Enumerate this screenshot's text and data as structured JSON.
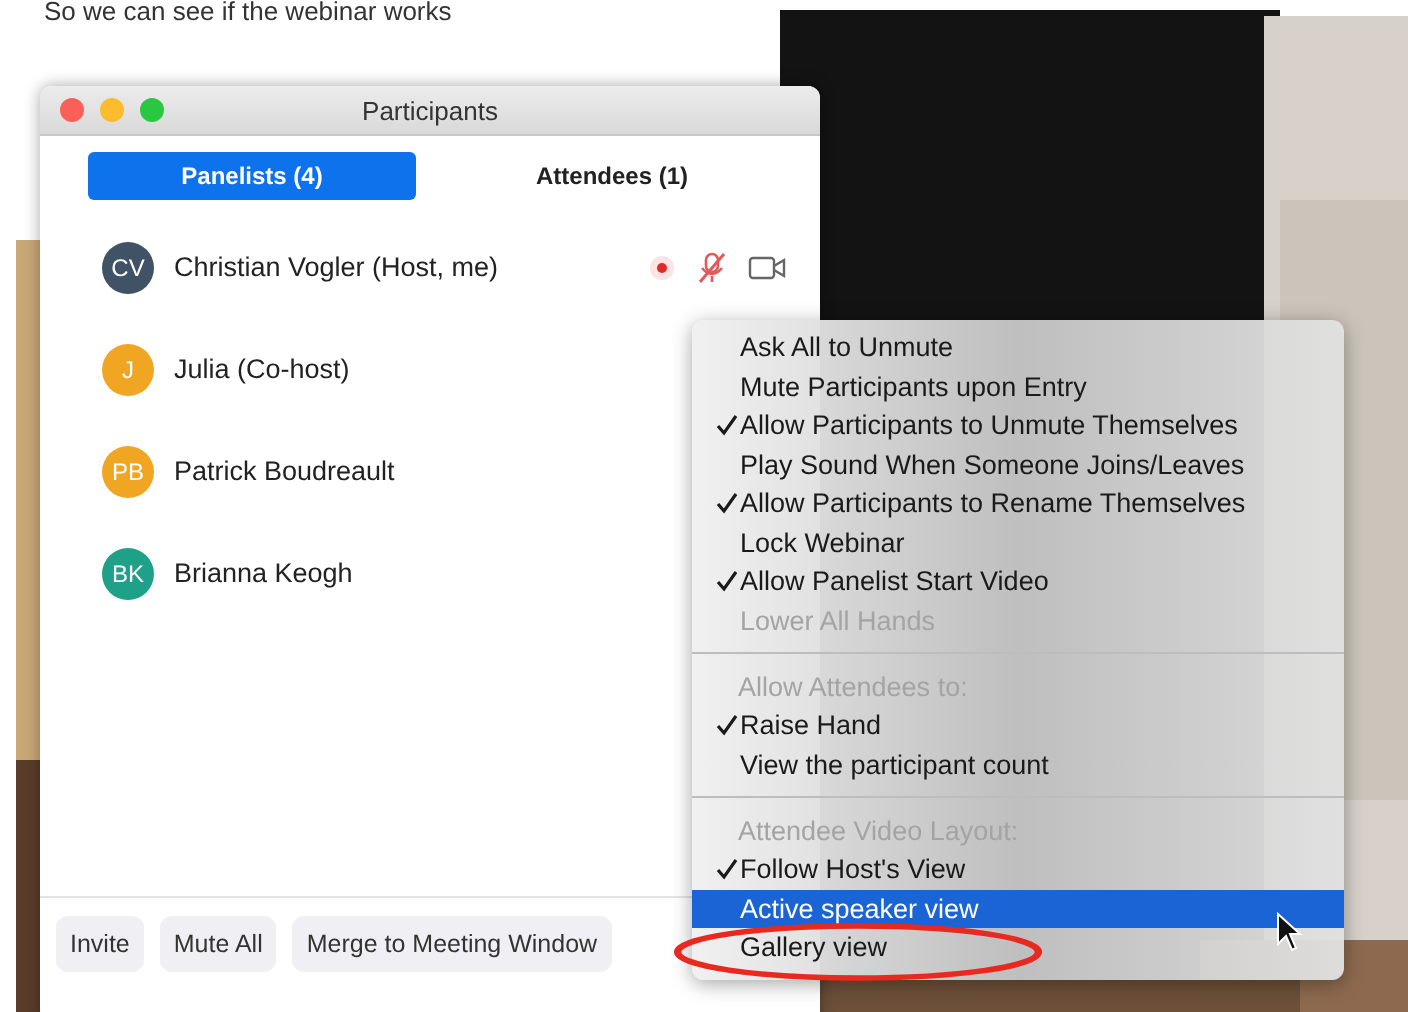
{
  "caption": "So we can see if the webinar works",
  "window": {
    "title": "Participants"
  },
  "tabs": [
    {
      "label": "Panelists (4)",
      "selected": true
    },
    {
      "label": "Attendees (1)",
      "selected": false
    }
  ],
  "participants": [
    {
      "initials": "CV",
      "name": "Christian Vogler (Host, me)",
      "color": "#3f5266",
      "hovered": true
    },
    {
      "initials": "J",
      "name": "Julia (Co-host)",
      "color": "#f0a623",
      "hovered": false
    },
    {
      "initials": "PB",
      "name": "Patrick Boudreault",
      "color": "#f0a623",
      "hovered": false
    },
    {
      "initials": "BK",
      "name": "Brianna Keogh",
      "color": "#1fa089",
      "hovered": false
    }
  ],
  "buttons": [
    "Invite",
    "Mute All",
    "Merge to Meeting Window"
  ],
  "menu": [
    {
      "kind": "item",
      "label": "Ask All to Unmute",
      "checked": false,
      "disabled": false,
      "selected": false
    },
    {
      "kind": "item",
      "label": "Mute Participants upon Entry",
      "checked": false,
      "disabled": false,
      "selected": false
    },
    {
      "kind": "item",
      "label": "Allow Participants to Unmute Themselves",
      "checked": true,
      "disabled": false,
      "selected": false
    },
    {
      "kind": "item",
      "label": "Play Sound When Someone Joins/Leaves",
      "checked": false,
      "disabled": false,
      "selected": false
    },
    {
      "kind": "item",
      "label": "Allow Participants to Rename Themselves",
      "checked": true,
      "disabled": false,
      "selected": false
    },
    {
      "kind": "item",
      "label": "Lock Webinar",
      "checked": false,
      "disabled": false,
      "selected": false
    },
    {
      "kind": "item",
      "label": "Allow Panelist Start Video",
      "checked": true,
      "disabled": false,
      "selected": false
    },
    {
      "kind": "item",
      "label": "Lower All Hands",
      "checked": false,
      "disabled": true,
      "selected": false
    },
    {
      "kind": "separator"
    },
    {
      "kind": "header",
      "label": "Allow Attendees to:"
    },
    {
      "kind": "item",
      "label": "Raise Hand",
      "checked": true,
      "disabled": false,
      "selected": false
    },
    {
      "kind": "item",
      "label": "View the participant count",
      "checked": false,
      "disabled": false,
      "selected": false
    },
    {
      "kind": "separator"
    },
    {
      "kind": "header",
      "label": "Attendee Video Layout:"
    },
    {
      "kind": "item",
      "label": "Follow Host's View",
      "checked": true,
      "disabled": false,
      "selected": false
    },
    {
      "kind": "item",
      "label": "Active speaker view",
      "checked": false,
      "disabled": false,
      "selected": true
    },
    {
      "kind": "item",
      "label": "Gallery view",
      "checked": false,
      "disabled": false,
      "selected": false,
      "circled": true
    }
  ]
}
